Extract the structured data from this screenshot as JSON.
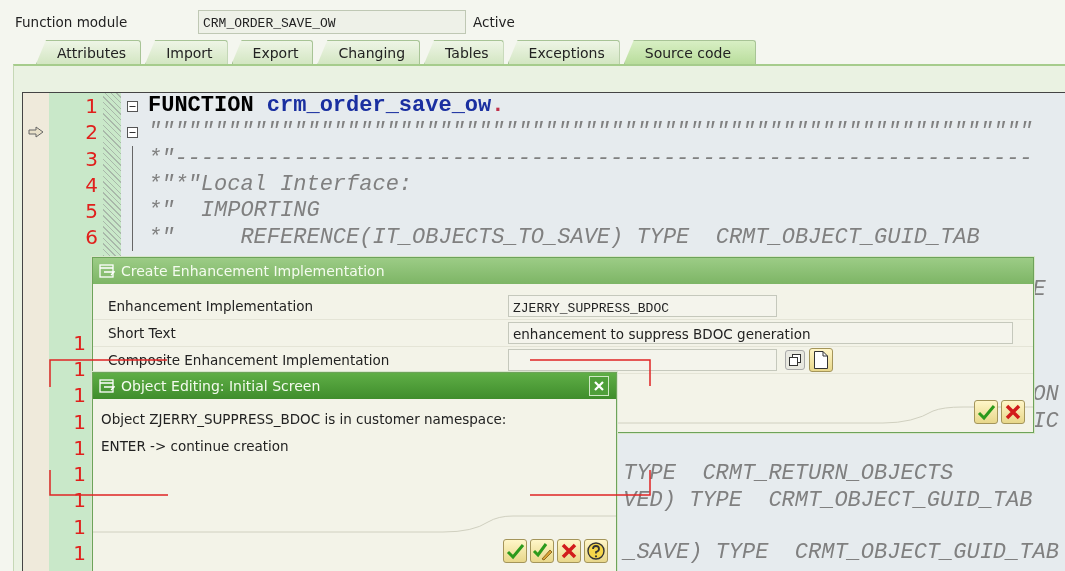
{
  "function_module": {
    "label": "Function module",
    "value": "CRM_ORDER_SAVE_OW",
    "status": "Active"
  },
  "tabs": [
    {
      "label": "Attributes",
      "selected": false
    },
    {
      "label": "Import",
      "selected": false
    },
    {
      "label": "Export",
      "selected": false
    },
    {
      "label": "Changing",
      "selected": false
    },
    {
      "label": "Tables",
      "selected": false
    },
    {
      "label": "Exceptions",
      "selected": false
    },
    {
      "label": "Source code",
      "selected": true
    }
  ],
  "editor": {
    "lines": [
      {
        "number": "1",
        "fold": true,
        "current": false,
        "segments": [
          {
            "kind": "keyword",
            "text": "FUNCTION"
          },
          {
            "kind": "name",
            "text": "crm_order_save_ow"
          },
          {
            "kind": "punct",
            "text": "."
          }
        ]
      },
      {
        "number": "2",
        "fold": true,
        "current": true,
        "segments": [
          {
            "kind": "comment",
            "text": "\"\"\"\"\"\"\"\"\"\"\"\"\"\"\"\"\"\"\"\"\"\"\"\"\"\"\"\"\"\"\"\"\"\"\"\"\"\"\"\"\"\"\"\"\"\"\"\"\"\"\"\"\"\"\"\"\"\"\"\"\"\"\"\"\"\"\""
          }
        ]
      },
      {
        "number": "3",
        "fold": false,
        "current": false,
        "segments": [
          {
            "kind": "comment",
            "text": "*\"-----------------------------------------------------------------"
          }
        ]
      },
      {
        "number": "4",
        "fold": false,
        "current": false,
        "segments": [
          {
            "kind": "comment",
            "text": "*\"*\"Local Interface:"
          }
        ]
      },
      {
        "number": "5",
        "fold": false,
        "current": false,
        "segments": [
          {
            "kind": "comment",
            "text": "*\"  IMPORTING"
          }
        ]
      },
      {
        "number": "6",
        "fold": false,
        "current": false,
        "segments": [
          {
            "kind": "comment",
            "text": "*\"     REFERENCE(IT_OBJECTS_TO_SAVE) TYPE  CRMT_OBJECT_GUID_TAB"
          }
        ]
      },
      {
        "current": false
      },
      {
        "current": false,
        "segments": [
          {
            "kind": "comment",
            "text": "E"
          }
        ]
      },
      {
        "current": false
      },
      {
        "number": "1",
        "current": false
      },
      {
        "number": "1",
        "current": false
      },
      {
        "number": "1",
        "current": false,
        "segments": [
          {
            "kind": "comment",
            "text": "ON"
          }
        ]
      },
      {
        "number": "1",
        "current": false,
        "segments": [
          {
            "kind": "comment",
            "text": "IC"
          }
        ]
      },
      {
        "number": "1",
        "current": false
      },
      {
        "number": "1",
        "current": false,
        "segments": [
          {
            "kind": "comment",
            "text": "TYPE  CRMT_RETURN_OBJECTS"
          }
        ]
      },
      {
        "number": "1",
        "current": false,
        "segments": [
          {
            "kind": "comment",
            "text": "VED) TYPE  CRMT_OBJECT_GUID_TAB"
          }
        ]
      },
      {
        "number": "1",
        "current": false
      },
      {
        "number": "1",
        "current": false,
        "segments": [
          {
            "kind": "comment",
            "text": "_SAVE) TYPE  CRMT_OBJECT_GUID_TAB"
          }
        ]
      }
    ]
  },
  "enhancement_dialog": {
    "title": "Create Enhancement Implementation",
    "fields": [
      {
        "label": "Enhancement Implementation",
        "value": "ZJERRY_SUPPRESS_BDOC",
        "kind": "code"
      },
      {
        "label": "Short Text",
        "value": "enhancement to suppress BDOC generation",
        "kind": "text"
      },
      {
        "label": "Composite Enhancement Implementation",
        "kind": "lookup"
      }
    ],
    "buttons": [
      {
        "kind": "confirm"
      },
      {
        "kind": "cancel"
      }
    ]
  },
  "editing_dialog": {
    "title": "Object Editing: Initial Screen",
    "messages": [
      "Object ZJERRY_SUPPRESS_BDOC is in customer namespace:",
      "ENTER -> continue creation"
    ],
    "buttons": [
      {
        "kind": "confirm"
      },
      {
        "kind": "confirm_edit"
      },
      {
        "kind": "cancel"
      },
      {
        "kind": "help"
      }
    ]
  }
}
